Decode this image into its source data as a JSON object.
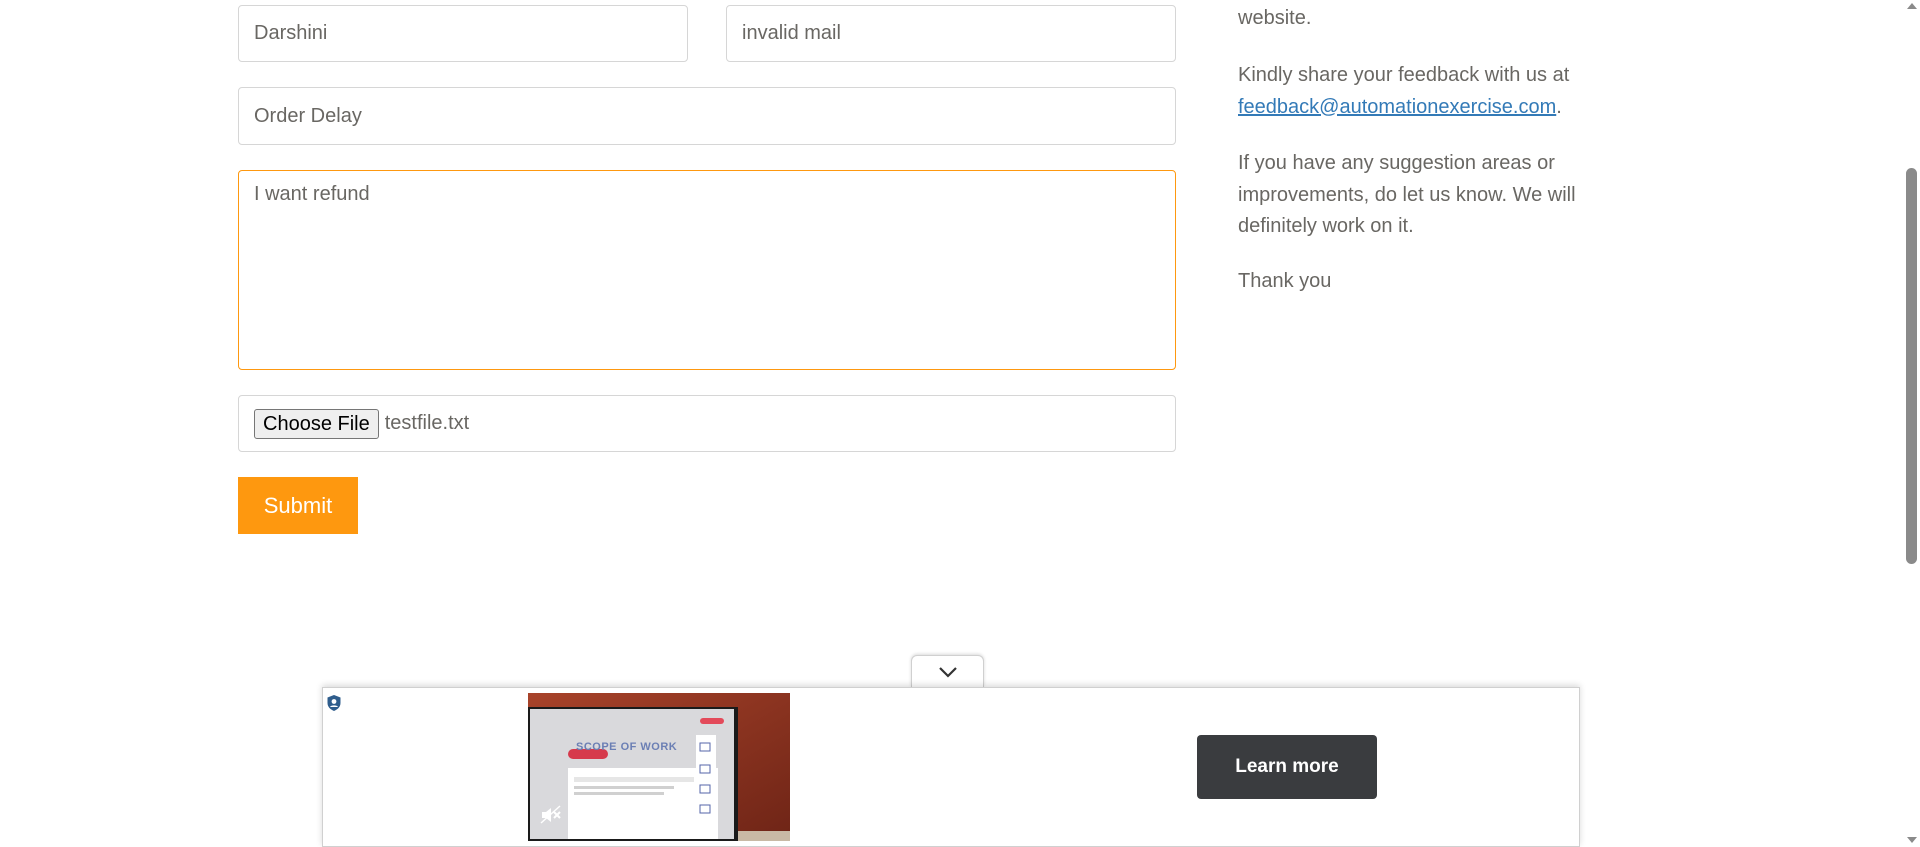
{
  "form": {
    "name_value": "Darshini",
    "email_value": "invalid mail",
    "subject_value": "Order Delay",
    "message_value": "I want refund",
    "file_button_label": "Choose File",
    "file_name": "testfile.txt",
    "submit_label": "Submit"
  },
  "info": {
    "line_website": "website.",
    "feedback_prefix": "Kindly share your feedback with us at",
    "feedback_email": "feedback@automationexercise.com",
    "feedback_suffix": ".",
    "suggestion_text": "If you have any suggestion areas or improvements, do let us know. We will definitely work on it.",
    "thanks": "Thank you"
  },
  "ad": {
    "learn_more_label": "Learn more",
    "video_title": "SCOPE OF WORK"
  },
  "colors": {
    "accent_orange": "#FE980F",
    "link_blue": "#337AB7",
    "text_gray": "#696763",
    "ad_button": "#3A3C3F"
  },
  "icons": {
    "collapse": "chevron-down-icon",
    "ad_badge": "shield-icon",
    "video_mute": "muted-speaker-icon"
  }
}
